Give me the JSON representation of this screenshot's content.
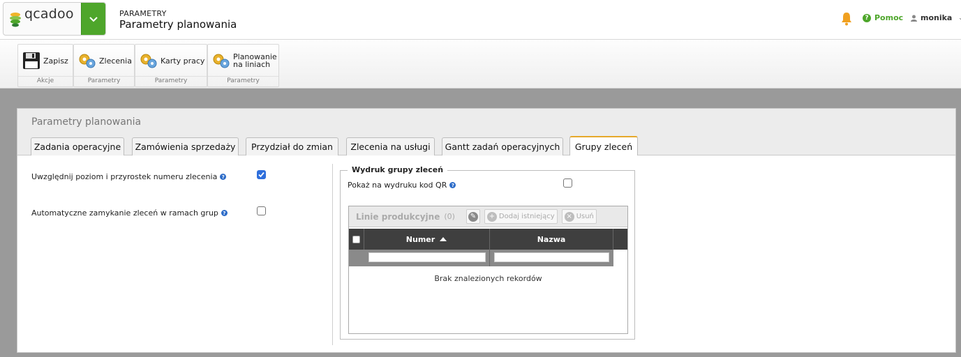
{
  "header": {
    "logo_text": "qcadoo",
    "breadcrumb_section": "PARAMETRY",
    "breadcrumb_page": "Parametry planowania",
    "help_label": "Pomoc",
    "user_name": "monika"
  },
  "ribbon": {
    "save_label": "Zapisz",
    "group_actions": "Akcje",
    "orders_label": "Zlecenia",
    "group_params_1": "Parametry",
    "work_cards_label": "Karty pracy",
    "group_params_2": "Parametry",
    "line_planning_line1": "Planowanie",
    "line_planning_line2": "na liniach",
    "group_params_3": "Parametry"
  },
  "panel": {
    "title": "Parametry planowania",
    "tabs": [
      "Zadania operacyjne",
      "Zamówienia sprzedaży",
      "Przydział do zmian",
      "Zlecenia na usługi",
      "Gantt zadań operacyjnych",
      "Grupy zleceń"
    ],
    "active_tab": "Grupy zleceń"
  },
  "form": {
    "include_level_label": "Uwzględnij poziom i przyrostek numeru zlecenia",
    "include_level_checked": true,
    "auto_close_label": "Automatyczne zamykanie zleceń w ramach grup",
    "auto_close_checked": false
  },
  "print_group": {
    "legend": "Wydruk grupy zleceń",
    "qr_label": "Pokaż na wydruku kod QR",
    "qr_checked": false
  },
  "grid": {
    "title": "Linie produkcyjne",
    "count": "(0)",
    "add_existing_label": "Dodaj istniejący",
    "remove_label": "Usuń",
    "columns": [
      "Numer",
      "Nazwa"
    ],
    "sort_column": "Numer",
    "sort_direction": "ascending",
    "empty_message": "Brak znalezionych rekordów"
  },
  "colors": {
    "accent_green": "#4ea62b",
    "active_tab_border": "#e6a82a",
    "checkbox_blue": "#2f6fdc",
    "header_dark": "#3f3f3f"
  }
}
